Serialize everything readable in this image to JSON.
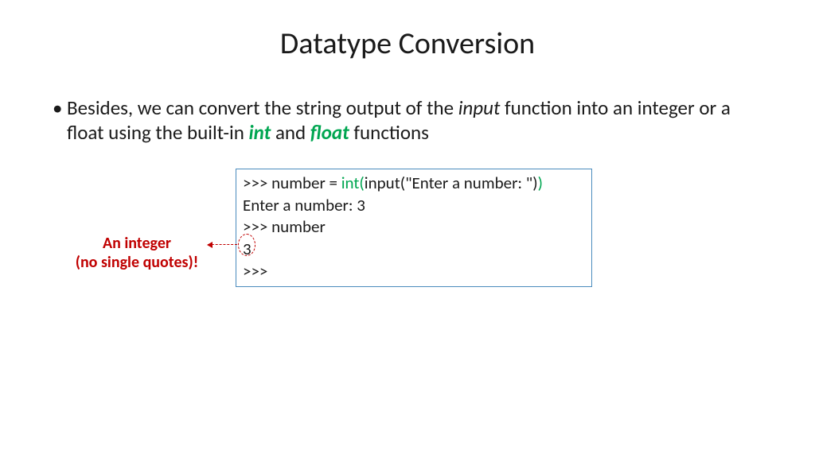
{
  "title": "Datatype Conversion",
  "bullet": {
    "pre": "Besides, we can convert the string output of the ",
    "input_word": "input",
    "mid1": " function into an integer or a float using the built-in ",
    "int_word": "int",
    "and_word": " and ",
    "float_word": "float",
    "post": " functions"
  },
  "code": {
    "l1_a": ">>> number = ",
    "l1_b": "int(",
    "l1_c": "input(\"Enter a number: \")",
    "l1_d": ")",
    "l2": "Enter a number: 3",
    "l3": ">>> number",
    "l4": "3",
    "l5": ">>>"
  },
  "annotation": {
    "line1": "An integer",
    "line2": "(no single quotes)!"
  }
}
